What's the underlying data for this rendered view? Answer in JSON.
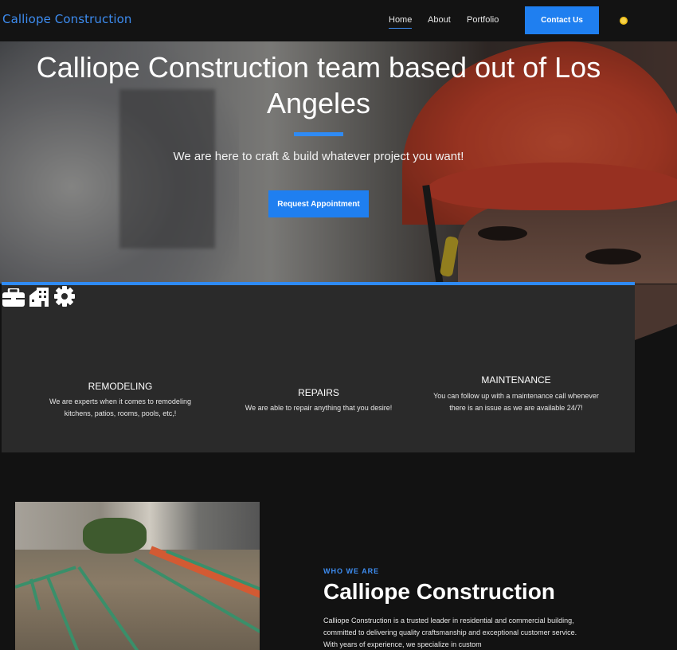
{
  "brand": {
    "name": "Calliope Construction"
  },
  "nav": {
    "items": [
      {
        "label": "Home",
        "active": true
      },
      {
        "label": "About"
      },
      {
        "label": "Portfolio"
      }
    ],
    "contact_label": "Contact Us",
    "theme_icon": "sun-icon"
  },
  "hero": {
    "title": "Calliope Construction team based out of Los Angeles",
    "subtitle": "We are here to craft & build whatever project you want!",
    "cta_label": "Request Appointment"
  },
  "services": [
    {
      "icon": "toolbox-icon",
      "title": "REMODELING",
      "description": "We are experts when it comes to remodeling kitchens, patios, rooms, pools, etc,!"
    },
    {
      "icon": "building-icon",
      "title": "REPAIRS",
      "description": "We are able to repair anything that you desire!"
    },
    {
      "icon": "gear-icon",
      "title": "MAINTENANCE",
      "description": "You can follow up with a maintenance call whenever there is an issue as we are available 24/7!"
    }
  ],
  "about": {
    "eyebrow": "WHO WE ARE",
    "title": "Calliope Construction",
    "text": "Calliope Construction is a trusted leader in residential and commercial building, committed to delivering quality craftsmanship and exceptional customer service. With years of experience, we specialize in custom"
  },
  "colors": {
    "accent": "#1f7ff0",
    "brand": "#3d8cf0",
    "background": "#121212",
    "panel": "#2a2a2a"
  }
}
